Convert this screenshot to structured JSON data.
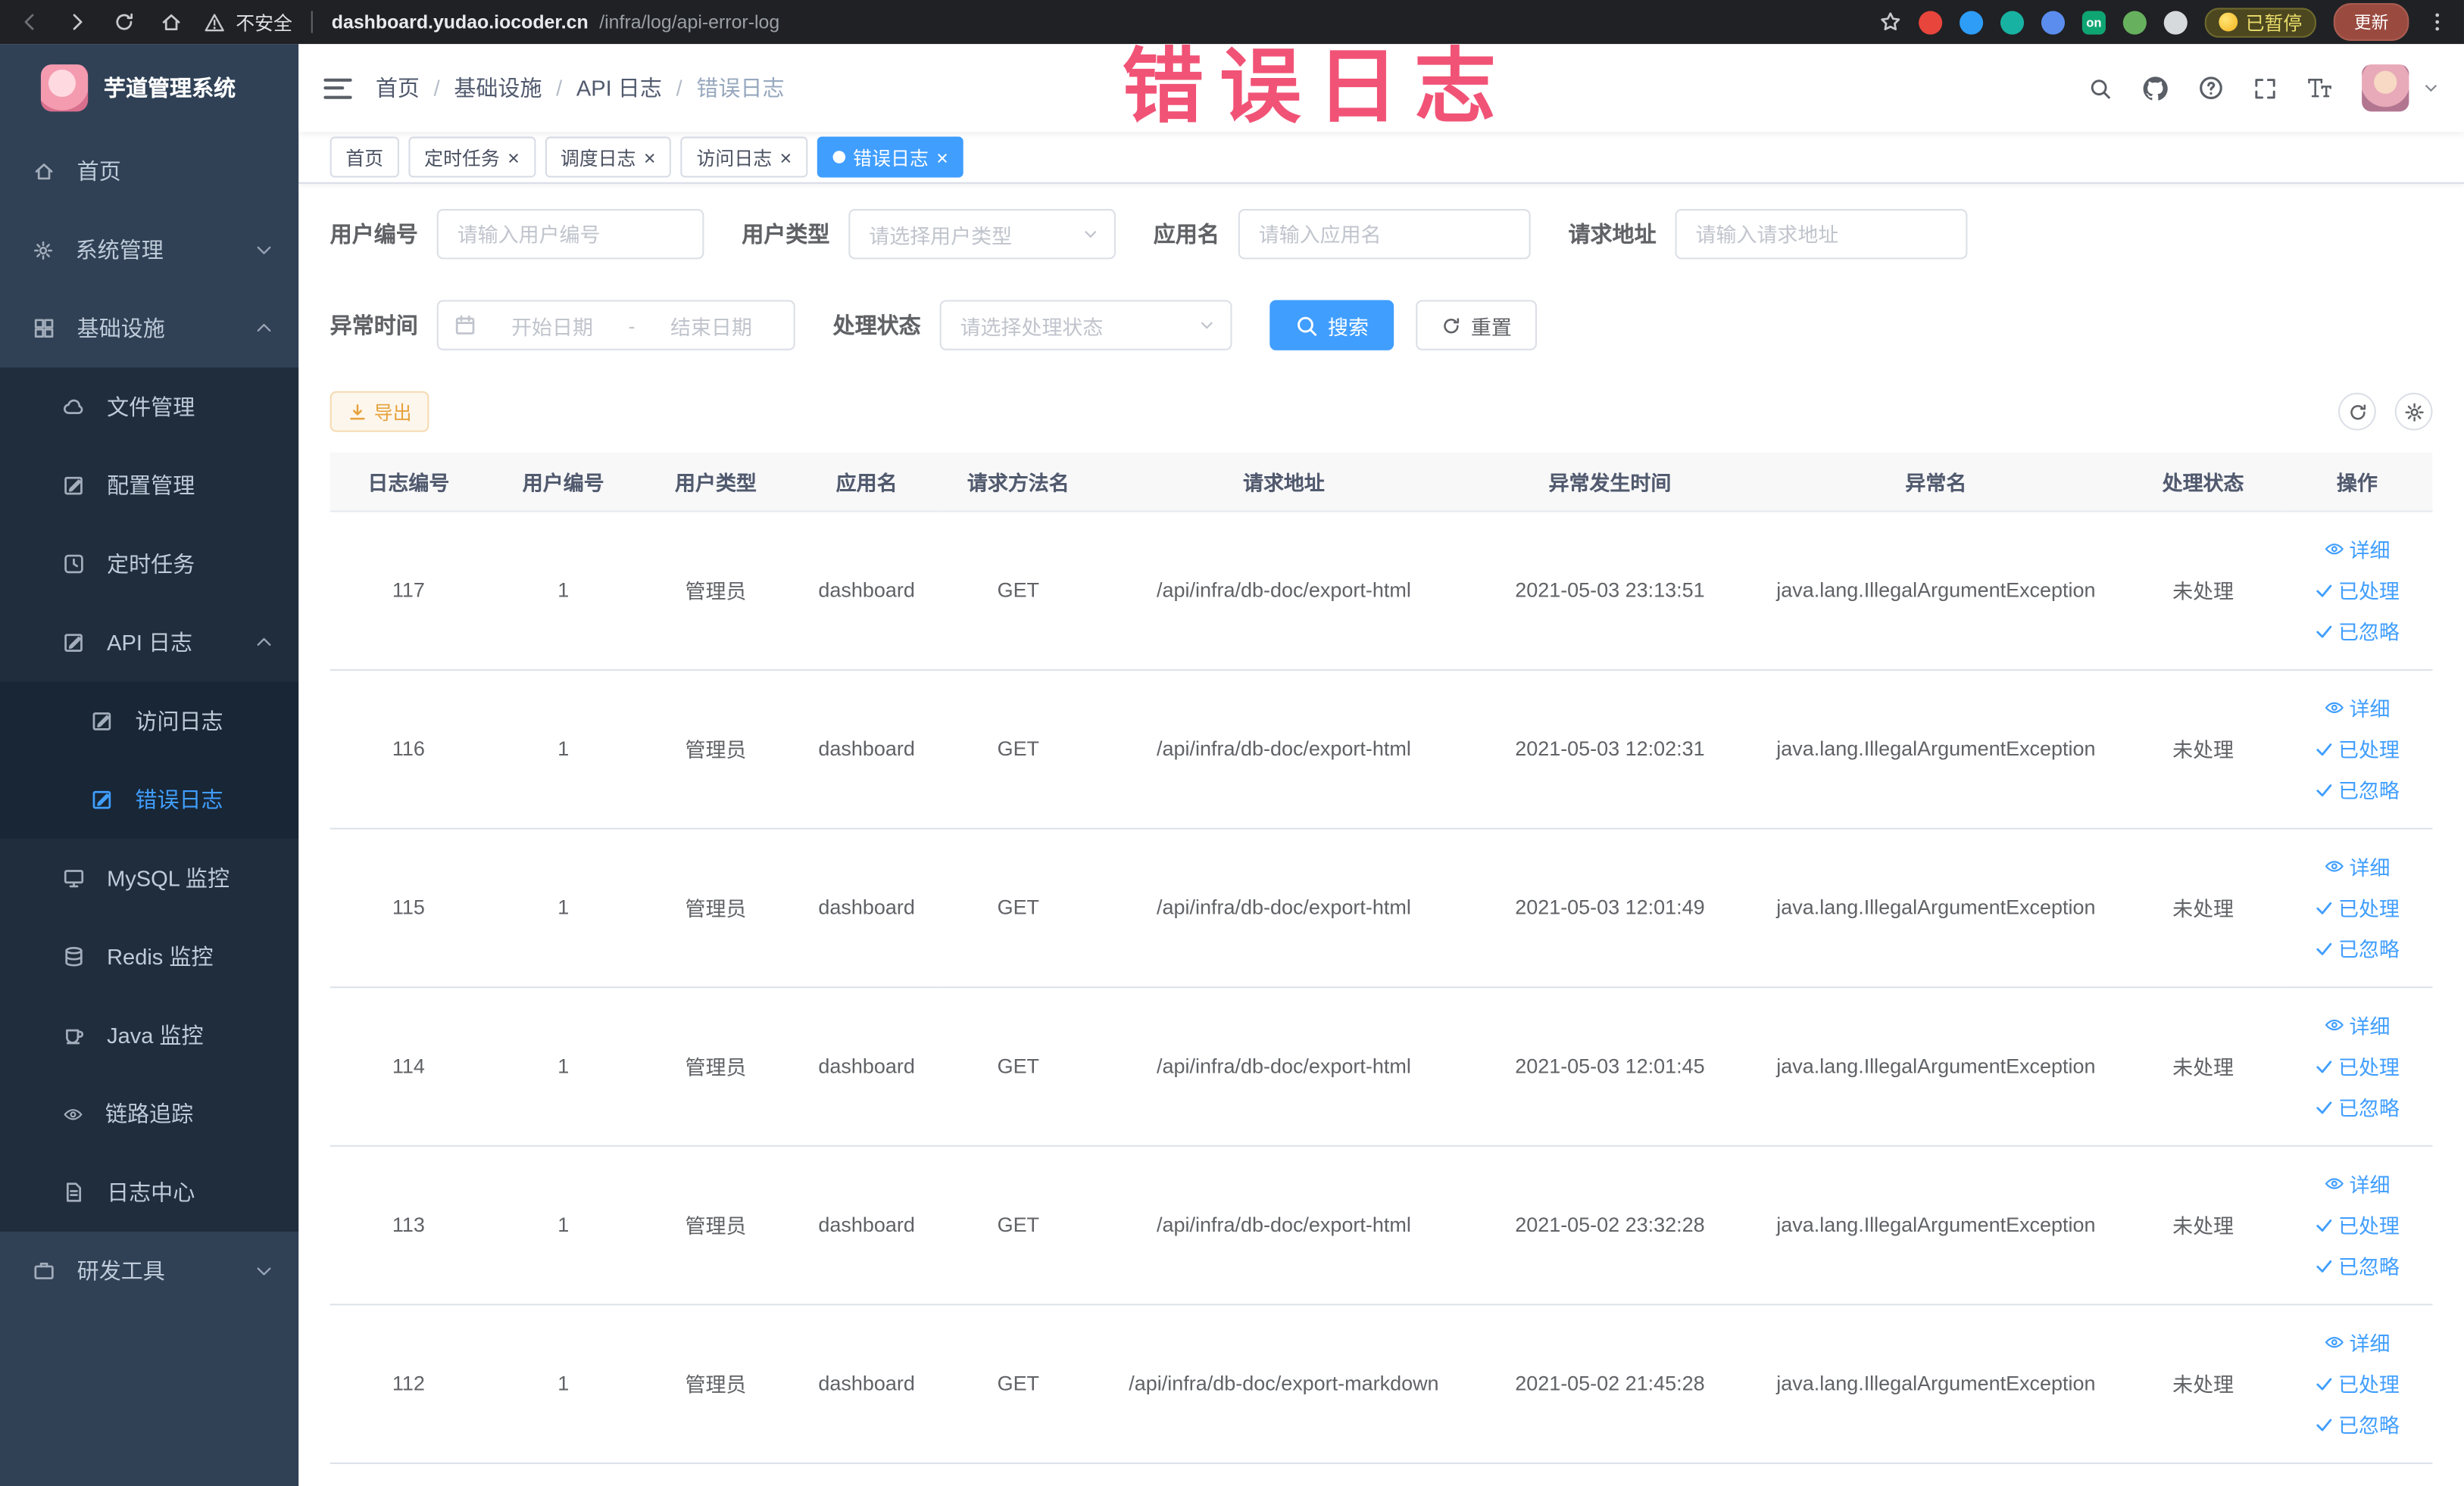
{
  "colors": {
    "primary": "#409eff",
    "warning": "#e6a23c",
    "annotation": "#f0456b",
    "sidebar_bg": "#304156",
    "sidebar_sub_bg": "#1f2d3d",
    "chrome_bg": "#202124"
  },
  "annotation": "错误日志",
  "browser": {
    "security_label": "不安全",
    "url_host": "dashboard.yudao.iocoder.cn",
    "url_path": "/infra/log/api-error-log",
    "ext_badge": "on",
    "paused_badge": "已暂停",
    "update_button": "更新"
  },
  "sidebar": {
    "logo_title": "芋道管理系统",
    "items": [
      {
        "key": "home",
        "label": "首页",
        "icon": "home",
        "level": 1
      },
      {
        "key": "system-management",
        "label": "系统管理",
        "icon": "gear",
        "level": 1,
        "arrow": "down"
      },
      {
        "key": "infrastructure",
        "label": "基础设施",
        "icon": "grid",
        "level": 1,
        "arrow": "up"
      },
      {
        "key": "file-management",
        "label": "文件管理",
        "icon": "cloud",
        "level": 2
      },
      {
        "key": "config-management",
        "label": "配置管理",
        "icon": "edit-square",
        "level": 2
      },
      {
        "key": "scheduled-jobs",
        "label": "定时任务",
        "icon": "clock-square",
        "level": 2
      },
      {
        "key": "api-logs",
        "label": "API 日志",
        "icon": "edit-square",
        "level": 2,
        "arrow": "up"
      },
      {
        "key": "access-log",
        "label": "访问日志",
        "icon": "edit-square",
        "level": 3
      },
      {
        "key": "error-log",
        "label": "错误日志",
        "icon": "edit-square",
        "level": 3,
        "active": true
      },
      {
        "key": "mysql-monitor",
        "label": "MySQL 监控",
        "icon": "monitor",
        "level": 2
      },
      {
        "key": "redis-monitor",
        "label": "Redis 监控",
        "icon": "database",
        "level": 2
      },
      {
        "key": "java-monitor",
        "label": "Java 监控",
        "icon": "coffee-cup",
        "level": 2
      },
      {
        "key": "link-tracing",
        "label": "链路追踪",
        "icon": "eye",
        "level": 2
      },
      {
        "key": "log-center",
        "label": "日志中心",
        "icon": "document",
        "level": 2
      },
      {
        "key": "dev-tools",
        "label": "研发工具",
        "icon": "briefcase",
        "level": 1,
        "arrow": "down"
      }
    ]
  },
  "navbar": {
    "breadcrumb": [
      "首页",
      "基础设施",
      "API 日志",
      "错误日志"
    ]
  },
  "tags": [
    {
      "key": "home",
      "label": "首页",
      "closable": false,
      "active": false
    },
    {
      "key": "scheduled-jobs",
      "label": "定时任务",
      "closable": true,
      "active": false
    },
    {
      "key": "job-log",
      "label": "调度日志",
      "closable": true,
      "active": false
    },
    {
      "key": "access-log",
      "label": "访问日志",
      "closable": true,
      "active": false
    },
    {
      "key": "error-log",
      "label": "错误日志",
      "closable": true,
      "active": true
    }
  ],
  "filters": {
    "user_id": {
      "label": "用户编号",
      "placeholder": "请输入用户编号"
    },
    "user_type": {
      "label": "用户类型",
      "placeholder": "请选择用户类型"
    },
    "app_name": {
      "label": "应用名",
      "placeholder": "请输入应用名"
    },
    "request_url": {
      "label": "请求地址",
      "placeholder": "请输入请求地址"
    },
    "exception_time": {
      "label": "异常时间",
      "start_placeholder": "开始日期",
      "separator": "-",
      "end_placeholder": "结束日期"
    },
    "process_status": {
      "label": "处理状态",
      "placeholder": "请选择处理状态"
    },
    "search_button": "搜索",
    "reset_button": "重置"
  },
  "toolbar": {
    "export_label": "导出"
  },
  "table": {
    "columns": [
      "日志编号",
      "用户编号",
      "用户类型",
      "应用名",
      "请求方法名",
      "请求地址",
      "异常发生时间",
      "异常名",
      "处理状态",
      "操作"
    ],
    "action_labels": [
      "详细",
      "已处理",
      "已忽略"
    ],
    "rows": [
      {
        "id": "117",
        "user_id": "1",
        "user_type": "管理员",
        "app": "dashboard",
        "method": "GET",
        "url": "/api/infra/db-doc/export-html",
        "time": "2021-05-03 23:13:51",
        "exception": "java.lang.IllegalArgumentException",
        "status": "未处理"
      },
      {
        "id": "116",
        "user_id": "1",
        "user_type": "管理员",
        "app": "dashboard",
        "method": "GET",
        "url": "/api/infra/db-doc/export-html",
        "time": "2021-05-03 12:02:31",
        "exception": "java.lang.IllegalArgumentException",
        "status": "未处理"
      },
      {
        "id": "115",
        "user_id": "1",
        "user_type": "管理员",
        "app": "dashboard",
        "method": "GET",
        "url": "/api/infra/db-doc/export-html",
        "time": "2021-05-03 12:01:49",
        "exception": "java.lang.IllegalArgumentException",
        "status": "未处理"
      },
      {
        "id": "114",
        "user_id": "1",
        "user_type": "管理员",
        "app": "dashboard",
        "method": "GET",
        "url": "/api/infra/db-doc/export-html",
        "time": "2021-05-03 12:01:45",
        "exception": "java.lang.IllegalArgumentException",
        "status": "未处理"
      },
      {
        "id": "113",
        "user_id": "1",
        "user_type": "管理员",
        "app": "dashboard",
        "method": "GET",
        "url": "/api/infra/db-doc/export-html",
        "time": "2021-05-02 23:32:28",
        "exception": "java.lang.IllegalArgumentException",
        "status": "未处理"
      },
      {
        "id": "112",
        "user_id": "1",
        "user_type": "管理员",
        "app": "dashboard",
        "method": "GET",
        "url": "/api/infra/db-doc/export-markdown",
        "time": "2021-05-02 21:45:28",
        "exception": "java.lang.IllegalArgumentException",
        "status": "未处理"
      }
    ]
  }
}
